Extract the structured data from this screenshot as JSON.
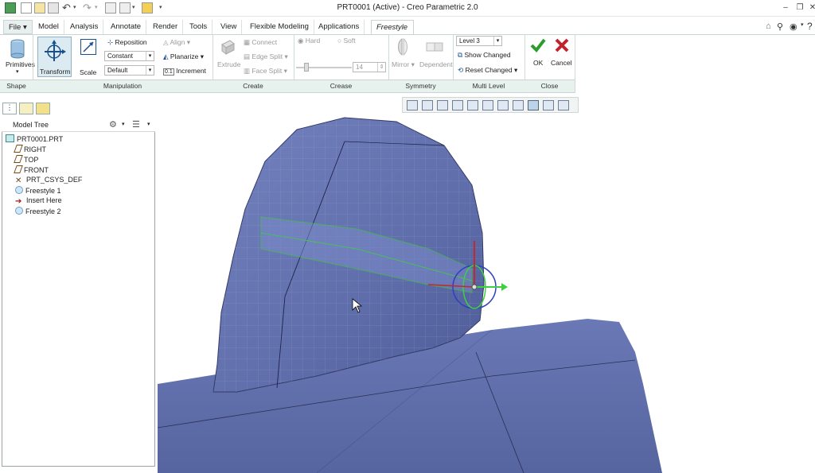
{
  "window": {
    "title": "PRT0001 (Active) - Creo Parametric 2.0"
  },
  "tabs": [
    "File",
    "Model",
    "Analysis",
    "Annotate",
    "Render",
    "Tools",
    "View",
    "Flexible Modeling",
    "Applications",
    "Freestyle"
  ],
  "ribbon": {
    "shape": {
      "primitives": "Primitives",
      "group_label": "Shape"
    },
    "manipulation": {
      "transform": "Transform",
      "scale": "Scale",
      "reposition": "Reposition",
      "constant": "Constant",
      "default": "Default",
      "align": "Align",
      "planarize": "Planarize",
      "increment": "Increment",
      "increment_value": "0.1",
      "group_label": "Manipulation"
    },
    "create": {
      "extrude": "Extrude",
      "connect": "Connect",
      "edge_split": "Edge Split",
      "face_split": "Face Split",
      "group_label": "Create"
    },
    "crease": {
      "hard": "Hard",
      "soft": "Soft",
      "value": "14",
      "group_label": "Crease"
    },
    "symmetry": {
      "mirror": "Mirror",
      "dependent": "Dependent",
      "group_label": "Symmetry"
    },
    "multilevel": {
      "level": "Level 3",
      "show_changed": "Show Changed",
      "reset_changed": "Reset Changed",
      "group_label": "Multi Level"
    },
    "close": {
      "ok": "OK",
      "cancel": "Cancel",
      "group_label": "Close"
    }
  },
  "model_tree": {
    "title": "Model Tree",
    "items": [
      {
        "label": "PRT0001.PRT",
        "icon": "part-icon"
      },
      {
        "label": "RIGHT",
        "icon": "datum-plane-icon"
      },
      {
        "label": "TOP",
        "icon": "datum-plane-icon"
      },
      {
        "label": "FRONT",
        "icon": "datum-plane-icon"
      },
      {
        "label": "PRT_CSYS_DEF",
        "icon": "csys-icon"
      },
      {
        "label": "Freestyle 1",
        "icon": "freestyle-icon"
      },
      {
        "label": "Insert Here",
        "icon": "insert-arrow-icon"
      },
      {
        "label": "Freestyle 2",
        "icon": "freestyle-active-icon"
      }
    ]
  },
  "colors": {
    "ribbon_group_bg": "#e7f1ee",
    "model_blue": "#6877b4",
    "ok_green": "#2e9b2e",
    "cancel_red": "#c0232b",
    "selection_green": "#3fcf3f"
  }
}
